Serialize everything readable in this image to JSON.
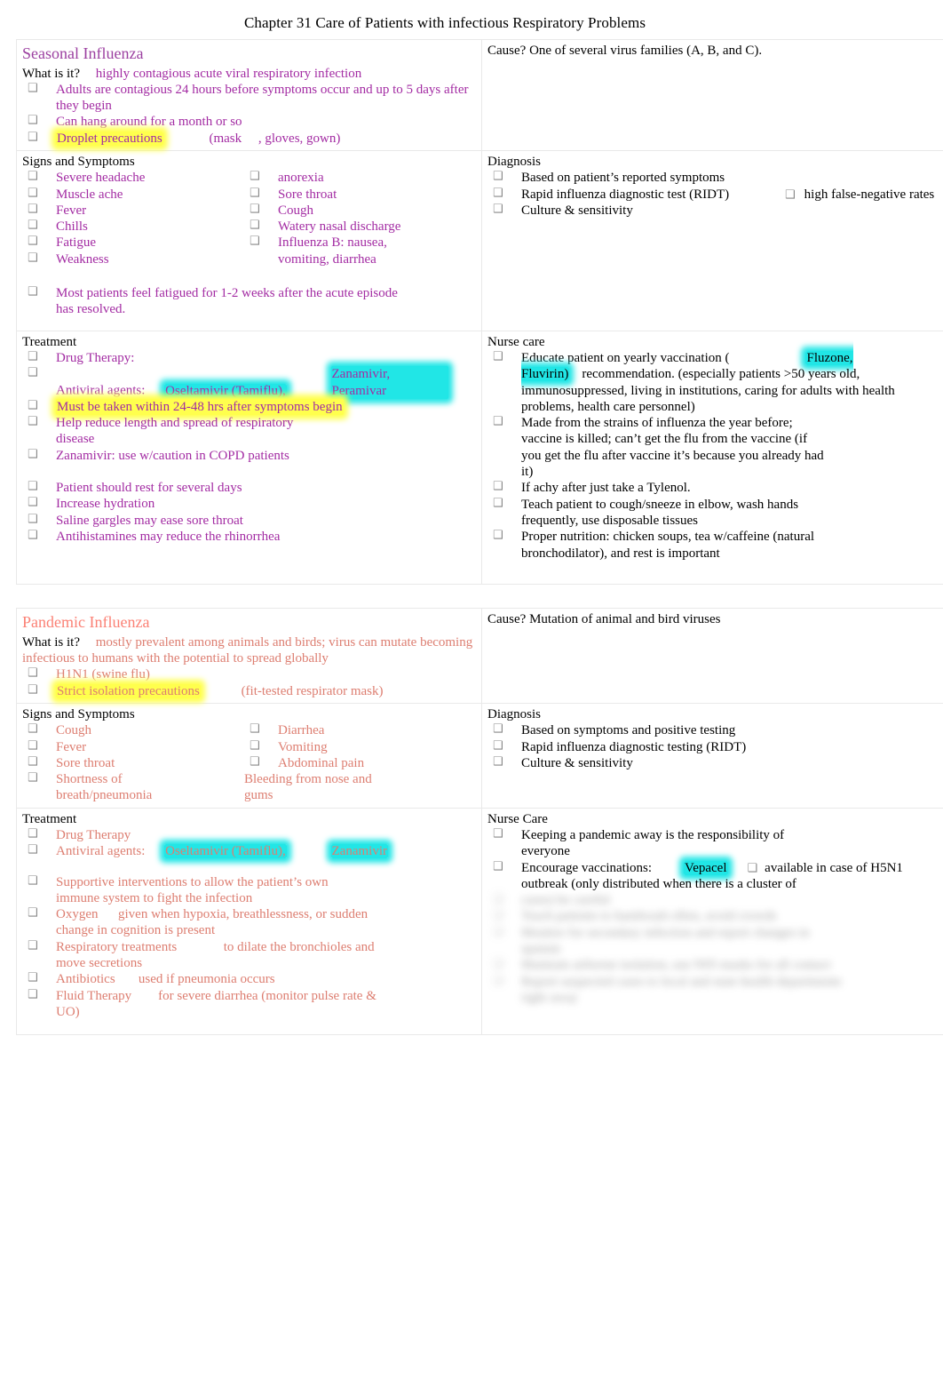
{
  "document": {
    "title": "Chapter 31 Care of Patients with infectious Respiratory Problems"
  },
  "colors": {
    "seasonal_heading": "#9b3fa0",
    "seasonal_text": "#a32ca3",
    "pandemic_heading": "#fb8175",
    "pandemic_text": "#dd7e71",
    "highlight_yellow": "#ffff4d",
    "highlight_cyan": "#21e6e6",
    "cell_border": "#e9e9e9"
  },
  "bullet_glyph": "❑",
  "seasonal": {
    "heading": "Seasonal Influenza",
    "what_is_it_label": "What is it?",
    "what_is_it_value": "highly contagious acute viral respiratory infection",
    "what_bullets": [
      "Adults are contagious 24 hours before symptoms occur and up to 5 days after they begin",
      "Can hang around for a month or so"
    ],
    "droplet_precautions": "Droplet precautions",
    "droplet_rest": "(mask     , gloves, gown)",
    "cause_text": "Cause? One of several virus families (A, B, and C).",
    "signs_label": "Signs and Symptoms",
    "signs_col1": [
      "Severe headache",
      "Muscle ache",
      "Fever",
      "Chills",
      "Fatigue",
      "Weakness"
    ],
    "signs_col2": [
      "anorexia",
      "Sore throat",
      "Cough",
      "Watery nasal discharge",
      "Influenza B: nausea, vomiting, diarrhea"
    ],
    "fatigue_note": "Most patients feel fatigued for 1-2 weeks after the acute episode has resolved.",
    "diagnosis_label": "Diagnosis",
    "diagnosis_items": [
      "Based on patient’s reported symptoms",
      "Rapid influenza diagnostic test (RIDT)",
      "Culture & sensitivity"
    ],
    "diagnosis_ridt_note_bullet": "❑",
    "diagnosis_ridt_note": "high false-negative rates",
    "treatment_label": "Treatment",
    "drug_therapy_label": "Drug Therapy:",
    "antiviral_label": "Antiviral agents:",
    "antiviral_drug1": "Oseltamivir (Tamiflu),",
    "antiviral_drug2": "Zanamivir, Peramivar",
    "antiviral_sub": [
      "Must be taken within 24-48 hrs after symptoms begin",
      "Help reduce length and spread of respiratory disease",
      "Zanamivir: use w/caution in COPD patients"
    ],
    "antiviral_sub_highlight_index": 0,
    "treatment_items": [
      "Patient should rest for several days",
      "Increase hydration",
      "Saline gargles may ease sore throat",
      "Antihistamines may reduce the rhinorrhea"
    ],
    "nurse_care_label": "Nurse care",
    "nurse_vaccine_pre": "Educate patient on yearly vaccination (",
    "nurse_vaccine_hl": "Fluzone, Fluvirin)",
    "nurse_vaccine_post": "recommendation. (especially patients >50 years old, immunosuppressed, living in institutions, caring for adults with health problems, health care personnel)",
    "nurse_vaccine_subs": [
      "Made from the strains of influenza the year before; vaccine is killed; can’t get the flu from the vaccine (if you get the flu after vaccine it’s because you already had it)",
      "If achy after just take a Tylenol."
    ],
    "nurse_items": [
      "Teach patient to cough/sneeze in elbow, wash hands frequently, use disposable tissues",
      "Proper nutrition: chicken soups, tea w/caffeine (natural bronchodilator), and rest is important"
    ]
  },
  "pandemic": {
    "heading": "Pandemic Influenza",
    "what_is_it_label": "What is it?",
    "what_is_it_value": "mostly prevalent among animals and birds; virus can mutate becoming infectious to humans with the potential to spread globally",
    "what_bullets": [
      "H1N1 (swine flu)"
    ],
    "strict_isolation": "Strict isolation precautions",
    "strict_isolation_rest": "(fit-tested respirator mask)",
    "cause_text": "Cause? Mutation of animal and bird viruses",
    "signs_label": "Signs and Symptoms",
    "signs_col1": [
      "Cough",
      "Fever",
      "Sore throat",
      "Shortness of breath/pneumonia"
    ],
    "signs_col2": [
      "Diarrhea",
      "Vomiting",
      "Abdominal pain"
    ],
    "signs_col2_extra": "Bleeding from nose and gums",
    "diagnosis_label": "Diagnosis",
    "diagnosis_items": [
      "Based on symptoms and positive testing",
      "Rapid influenza diagnostic testing (RIDT)",
      "Culture & sensitivity"
    ],
    "treatment_label": "Treatment",
    "drug_therapy_label": "Drug Therapy",
    "antiviral_label": "Antiviral agents:",
    "antiviral_drug1": "Oseltamivir (Tamiflu),",
    "antiviral_drug2": "Zanamivir",
    "treatment_items": [
      "Supportive interventions to allow the patient’s own immune system to fight the infection",
      "Oxygen      given when hypoxia, breathlessness, or sudden change in cognition is present",
      "Respiratory treatments              to dilate the bronchioles and move secretions",
      "Antibiotics       used if pneumonia occurs",
      "Fluid Therapy        for severe diarrhea (monitor pulse rate & UO)"
    ],
    "nurse_care_label": "Nurse Care",
    "nurse_item1": "Keeping a pandemic away is the responsibility of everyone",
    "nurse_item2_pre": "Encourage vaccinations:",
    "nurse_item2_hl": "Vepacel",
    "nurse_item2_bullet": "❑",
    "nurse_item2_post": "available in case of H5N1 outbreak (only distributed when there is a cluster of",
    "nurse_blurred_lines": [
      "cases) be careful",
      "Teach patients to handwash often, avoid crowds",
      "Monitor for secondary infection and report changes in sputum",
      "Maintain airborne isolation, use N95 masks for all contact",
      "Report suspected cases to local and state health departments right away"
    ]
  }
}
